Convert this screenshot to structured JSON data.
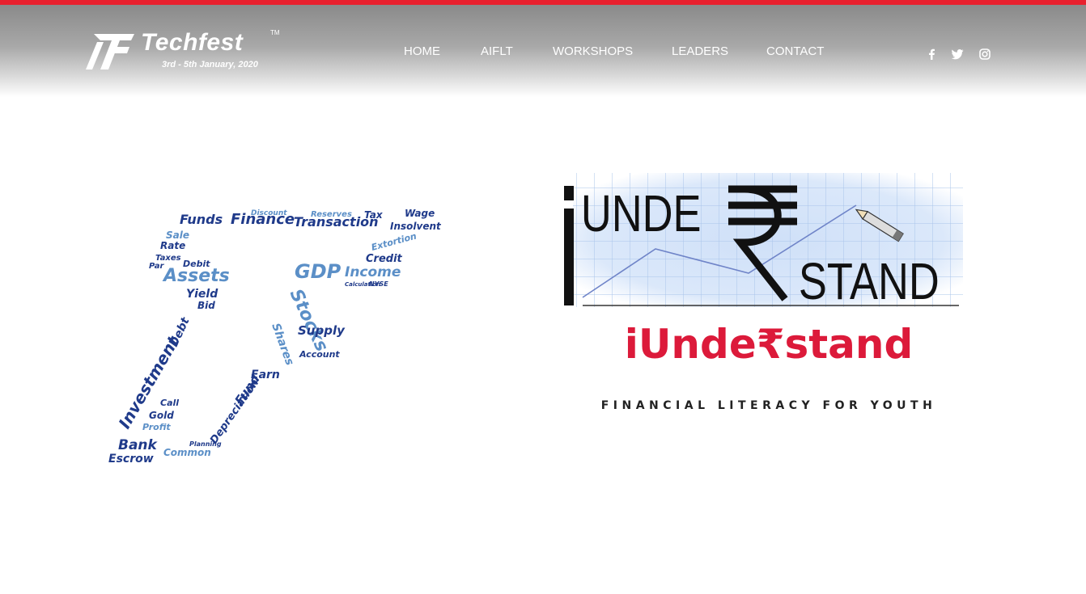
{
  "header": {
    "brand": "Techfest",
    "trademark": "TM",
    "dates": "3rd - 5th January, 2020",
    "nav": [
      "HOME",
      "AIFLT",
      "WORKSHOPS",
      "LEADERS",
      "CONTACT"
    ],
    "social": [
      "facebook-icon",
      "twitter-icon",
      "instagram-icon"
    ]
  },
  "hero": {
    "logo_top": "UNDE",
    "logo_bottom": "STAND",
    "title": "iUnde₹stand",
    "tagline": "FINANCIAL LITERACY FOR YOUTH"
  },
  "wordcloud": {
    "words": [
      "Funds",
      "Finance",
      "Transaction",
      "Tax",
      "Reserves",
      "Discount",
      "Wage",
      "Insolvent",
      "Sale",
      "Rate",
      "Taxes",
      "Par",
      "Debit",
      "Assets",
      "GDP",
      "Income",
      "Credit",
      "Extortion",
      "Yield",
      "Bid",
      "Stocks",
      "Supply",
      "Account",
      "Shares",
      "Debt",
      "Investment",
      "Earn",
      "Fund",
      "Call",
      "Gold",
      "Profit",
      "Depreciation",
      "Bank",
      "Escrow",
      "Common",
      "Planning",
      "NYSE",
      "Calculation"
    ]
  },
  "colors": {
    "accent": "#dc1a3a",
    "topline": "#e8202e",
    "wordcloud_dark": "#1f3a8a",
    "wordcloud_light": "#5b8fc7"
  }
}
